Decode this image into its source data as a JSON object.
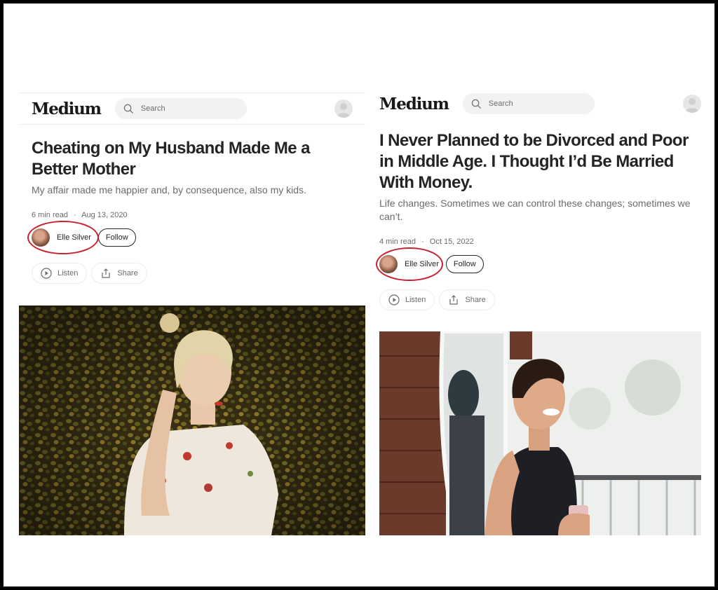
{
  "left": {
    "brand": "Medium",
    "search": {
      "placeholder": "Search"
    },
    "article": {
      "title": "Cheating on My Husband Made Me a Better Mother",
      "subtitle": "My affair made me happier and, by consequence, also my kids.",
      "read_time": "6 min read",
      "separator": "·",
      "date": "Aug 13, 2020"
    },
    "author": {
      "name": "Elle Silver",
      "follow_label": "Follow"
    },
    "actions": {
      "listen_label": "Listen",
      "share_label": "Share"
    }
  },
  "right": {
    "brand": "Medium",
    "search": {
      "placeholder": "Search"
    },
    "article": {
      "title": "I Never Planned to be Divorced and Poor in Middle Age. I Thought I’d Be Married With Money.",
      "subtitle": "Life changes. Sometimes we can control these changes; sometimes we can’t.",
      "read_time": "4 min read",
      "separator": "·",
      "date": "Oct 15, 2022"
    },
    "author": {
      "name": "Elle Silver",
      "follow_label": "Follow"
    },
    "actions": {
      "listen_label": "Listen",
      "share_label": "Share"
    }
  },
  "colors": {
    "annotation": "#c8202c",
    "text_primary": "#242424",
    "text_secondary": "#6b6b6b"
  },
  "icons": [
    "search-icon",
    "user-avatar-icon",
    "play-icon",
    "share-icon"
  ]
}
